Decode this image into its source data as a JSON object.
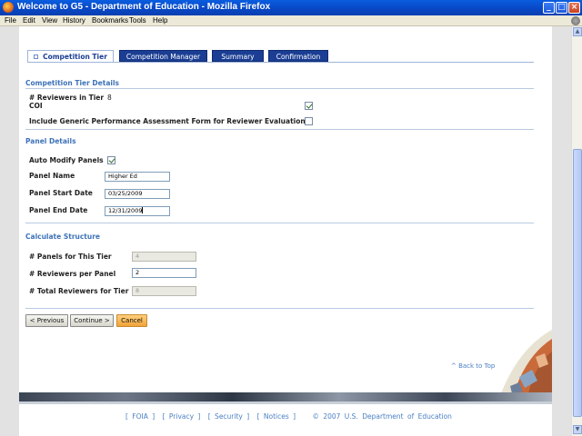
{
  "window": {
    "title": "Welcome to G5 - Department of Education - Mozilla Firefox",
    "controls": {
      "minimize": "_",
      "maximize": "□",
      "close": "×"
    }
  },
  "menu": [
    "File",
    "Edit",
    "View",
    "History",
    "Bookmarks",
    "Tools",
    "Help"
  ],
  "tabs": [
    {
      "label": "Competition Tier",
      "active": true
    },
    {
      "label": "Competition Manager",
      "active": false
    },
    {
      "label": "Summary",
      "active": false
    },
    {
      "label": "Confirmation",
      "active": false
    }
  ],
  "tier_details": {
    "heading": "Competition Tier Details",
    "reviewers_label": "# Reviewers in Tier",
    "reviewers_value": "8",
    "coi_label": "COI",
    "coi_checked": true,
    "generic_form_label": "Include Generic Performance Assessment Form for Reviewer Evaluation",
    "generic_form_checked": false
  },
  "panel_details": {
    "heading": "Panel Details",
    "auto_modify_label": "Auto Modify Panels",
    "auto_modify_checked": true,
    "panel_name_label": "Panel Name",
    "panel_name_value": "Higher Ed",
    "start_date_label": "Panel Start Date",
    "start_date_value": "03/25/2009",
    "end_date_label": "Panel End Date",
    "end_date_value": "12/31/2009"
  },
  "structure": {
    "heading": "Calculate Structure",
    "panels_label": "# Panels for This Tier",
    "panels_value": "4",
    "reviewers_per_panel_label": "# Reviewers per Panel",
    "reviewers_per_panel_value": "2",
    "total_reviewers_label": "# Total Reviewers for Tier",
    "total_reviewers_value": "8"
  },
  "buttons": {
    "previous": "< Previous",
    "continue": "Continue >",
    "cancel": "Cancel"
  },
  "back_to_top": "^ Back to Top",
  "footer": {
    "foia": "[ FOIA ]",
    "privacy": "[ Privacy ]",
    "security": "[ Security ]",
    "notices": "[ Notices ]",
    "copyright": "© 2007 U.S. Department of Education"
  }
}
